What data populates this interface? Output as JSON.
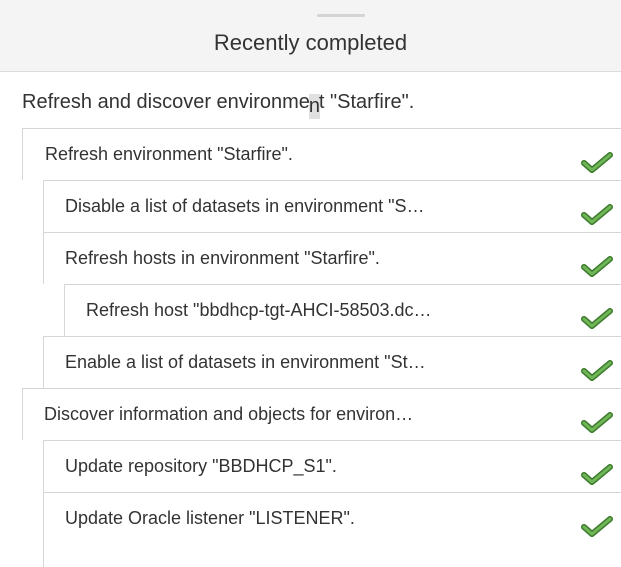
{
  "panel": {
    "title": "Recently completed",
    "root_task": {
      "label_before": "Refresh and discover environme",
      "label_cursor": "n",
      "label_after": "t \"Starfire\"."
    },
    "tasks": [
      {
        "label": "Refresh environment \"Starfire\".",
        "status": "completed",
        "status_icon": "check-icon"
      },
      {
        "label": "Disable a list of datasets in environment \"S…",
        "status": "completed",
        "status_icon": "check-icon"
      },
      {
        "label": "Refresh hosts in environment \"Starfire\".",
        "status": "completed",
        "status_icon": "check-icon"
      },
      {
        "label": "Refresh host \"bbdhcp-tgt-AHCI-58503.dc…",
        "status": "completed",
        "status_icon": "check-icon"
      },
      {
        "label": "Enable a list of datasets in environment \"St…",
        "status": "completed",
        "status_icon": "check-icon"
      },
      {
        "label": "Discover information and objects for environ…",
        "status": "completed",
        "status_icon": "check-icon"
      },
      {
        "label": "Update repository \"BBDHCP_S1\".",
        "status": "completed",
        "status_icon": "check-icon"
      },
      {
        "label": "Update Oracle listener \"LISTENER\".",
        "status": "completed",
        "status_icon": "check-icon"
      }
    ]
  },
  "colors": {
    "header_bg": "#f4f4f4",
    "check_green": "#5fa34a",
    "check_outline": "#3d7a2e",
    "border": "#d6d6d6"
  }
}
